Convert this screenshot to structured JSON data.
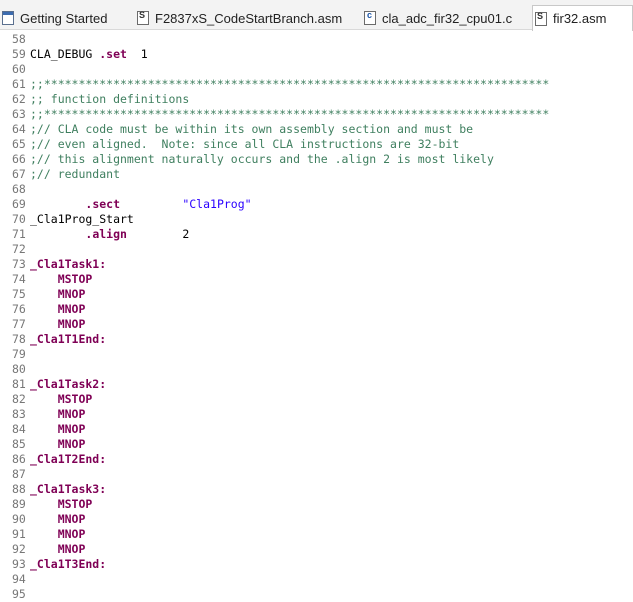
{
  "tabs": [
    {
      "label": "Getting Started",
      "icon": "document-icon",
      "active": false
    },
    {
      "label": "F2837xS_CodeStartBranch.asm",
      "icon": "asm-file-icon",
      "active": false
    },
    {
      "label": "cla_adc_fir32_cpu01.c",
      "icon": "c-file-icon",
      "active": false
    },
    {
      "label": "fir32.asm",
      "icon": "asm-file-icon",
      "active": true
    }
  ],
  "colors": {
    "comment": "#3f7f5f",
    "directive": "#7f0055",
    "string": "#2a00ff",
    "line_number": "#777777"
  },
  "lines": [
    {
      "num": "58",
      "parts": []
    },
    {
      "num": "59",
      "parts": [
        {
          "t": "CLA_DEBUG ",
          "c": "plain"
        },
        {
          "t": ".set",
          "c": "dir"
        },
        {
          "t": "  1",
          "c": "plain"
        }
      ]
    },
    {
      "num": "60",
      "parts": []
    },
    {
      "num": "61",
      "parts": [
        {
          "t": ";;*************************************************************************",
          "c": "comment"
        }
      ]
    },
    {
      "num": "62",
      "parts": [
        {
          "t": ";; function definitions",
          "c": "comment"
        }
      ]
    },
    {
      "num": "63",
      "parts": [
        {
          "t": ";;*************************************************************************",
          "c": "comment"
        }
      ]
    },
    {
      "num": "64",
      "parts": [
        {
          "t": ";// CLA code must be within its own assembly section and must be",
          "c": "comment"
        }
      ]
    },
    {
      "num": "65",
      "parts": [
        {
          "t": ";// even aligned.  Note: since all CLA instructions are 32-bit",
          "c": "comment"
        }
      ]
    },
    {
      "num": "66",
      "parts": [
        {
          "t": ";// this alignment naturally occurs and the .align 2 is most likely",
          "c": "comment"
        }
      ]
    },
    {
      "num": "67",
      "parts": [
        {
          "t": ";// redundant",
          "c": "comment"
        }
      ]
    },
    {
      "num": "68",
      "parts": []
    },
    {
      "num": "69",
      "parts": [
        {
          "t": "        ",
          "c": "plain"
        },
        {
          "t": ".sect",
          "c": "dir"
        },
        {
          "t": "         ",
          "c": "plain"
        },
        {
          "t": "\"Cla1Prog\"",
          "c": "str"
        }
      ]
    },
    {
      "num": "70",
      "parts": [
        {
          "t": "_Cla1Prog_Start",
          "c": "plain"
        }
      ]
    },
    {
      "num": "71",
      "parts": [
        {
          "t": "        ",
          "c": "plain"
        },
        {
          "t": ".align",
          "c": "dir"
        },
        {
          "t": "        2",
          "c": "plain"
        }
      ]
    },
    {
      "num": "72",
      "parts": []
    },
    {
      "num": "73",
      "parts": [
        {
          "t": "_Cla1Task1:",
          "c": "lbl"
        }
      ]
    },
    {
      "num": "74",
      "parts": [
        {
          "t": "    ",
          "c": "plain"
        },
        {
          "t": "MSTOP",
          "c": "ins"
        }
      ]
    },
    {
      "num": "75",
      "parts": [
        {
          "t": "    ",
          "c": "plain"
        },
        {
          "t": "MNOP",
          "c": "ins"
        }
      ]
    },
    {
      "num": "76",
      "parts": [
        {
          "t": "    ",
          "c": "plain"
        },
        {
          "t": "MNOP",
          "c": "ins"
        }
      ]
    },
    {
      "num": "77",
      "parts": [
        {
          "t": "    ",
          "c": "plain"
        },
        {
          "t": "MNOP",
          "c": "ins"
        }
      ]
    },
    {
      "num": "78",
      "parts": [
        {
          "t": "_Cla1T1End:",
          "c": "lbl"
        }
      ]
    },
    {
      "num": "79",
      "parts": []
    },
    {
      "num": "80",
      "parts": []
    },
    {
      "num": "81",
      "parts": [
        {
          "t": "_Cla1Task2:",
          "c": "lbl"
        }
      ]
    },
    {
      "num": "82",
      "parts": [
        {
          "t": "    ",
          "c": "plain"
        },
        {
          "t": "MSTOP",
          "c": "ins"
        }
      ]
    },
    {
      "num": "83",
      "parts": [
        {
          "t": "    ",
          "c": "plain"
        },
        {
          "t": "MNOP",
          "c": "ins"
        }
      ]
    },
    {
      "num": "84",
      "parts": [
        {
          "t": "    ",
          "c": "plain"
        },
        {
          "t": "MNOP",
          "c": "ins"
        }
      ]
    },
    {
      "num": "85",
      "parts": [
        {
          "t": "    ",
          "c": "plain"
        },
        {
          "t": "MNOP",
          "c": "ins"
        }
      ]
    },
    {
      "num": "86",
      "parts": [
        {
          "t": "_Cla1T2End:",
          "c": "lbl"
        }
      ]
    },
    {
      "num": "87",
      "parts": []
    },
    {
      "num": "88",
      "parts": [
        {
          "t": "_Cla1Task3:",
          "c": "lbl"
        }
      ]
    },
    {
      "num": "89",
      "parts": [
        {
          "t": "    ",
          "c": "plain"
        },
        {
          "t": "MSTOP",
          "c": "ins"
        }
      ]
    },
    {
      "num": "90",
      "parts": [
        {
          "t": "    ",
          "c": "plain"
        },
        {
          "t": "MNOP",
          "c": "ins"
        }
      ]
    },
    {
      "num": "91",
      "parts": [
        {
          "t": "    ",
          "c": "plain"
        },
        {
          "t": "MNOP",
          "c": "ins"
        }
      ]
    },
    {
      "num": "92",
      "parts": [
        {
          "t": "    ",
          "c": "plain"
        },
        {
          "t": "MNOP",
          "c": "ins"
        }
      ]
    },
    {
      "num": "93",
      "parts": [
        {
          "t": "_Cla1T3End:",
          "c": "lbl"
        }
      ]
    },
    {
      "num": "94",
      "parts": []
    },
    {
      "num": "95",
      "parts": []
    }
  ]
}
